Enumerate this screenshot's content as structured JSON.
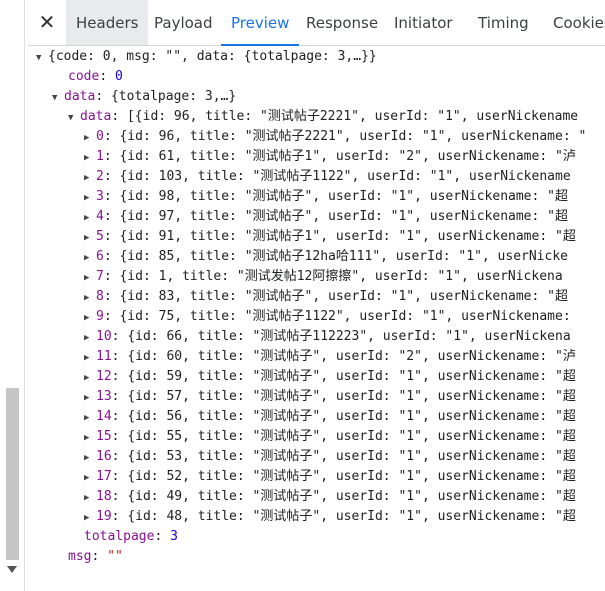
{
  "tabs": [
    {
      "label": "Headers",
      "state": "hovered"
    },
    {
      "label": "Payload",
      "state": "normal"
    },
    {
      "label": "Preview",
      "state": "active"
    },
    {
      "label": "Response",
      "state": "normal"
    },
    {
      "label": "Initiator",
      "state": "normal"
    },
    {
      "label": "Timing",
      "state": "normal"
    },
    {
      "label": "Cookies",
      "state": "normal"
    }
  ],
  "close_icon": "close-icon",
  "tree": {
    "root_summary": "{code: 0, msg: \"\", data: {totalpage: 3,…}}",
    "code_key": "code",
    "code_value": "0",
    "data_key": "data",
    "data_summary": "{totalpage: 3,…}",
    "list_key": "data",
    "list_summary": "[{id: 96, title: \"测试帖子2221\", userId: \"1\", userNickename",
    "items": [
      {
        "index": "0",
        "summary": "{id: 96, title: \"测试帖子2221\", userId: \"1\", userNickename: \""
      },
      {
        "index": "1",
        "summary": "{id: 61, title: \"测试帖子1\", userId: \"2\", userNickename: \"泸"
      },
      {
        "index": "2",
        "summary": "{id: 103, title: \"测试帖子1122\", userId: \"1\", userNickename"
      },
      {
        "index": "3",
        "summary": "{id: 98, title: \"测试帖子\", userId: \"1\", userNickename: \"超"
      },
      {
        "index": "4",
        "summary": "{id: 97, title: \"测试帖子\", userId: \"1\", userNickename: \"超"
      },
      {
        "index": "5",
        "summary": "{id: 91, title: \"测试帖子1\", userId: \"1\", userNickename: \"超"
      },
      {
        "index": "6",
        "summary": "{id: 85, title: \"测试帖子12ha哈111\", userId: \"1\", userNicke"
      },
      {
        "index": "7",
        "summary": "{id: 1, title: \"测试发帖12阿擦擦\", userId: \"1\", userNickena"
      },
      {
        "index": "8",
        "summary": "{id: 83, title: \"测试帖子\", userId: \"1\", userNickename: \"超"
      },
      {
        "index": "9",
        "summary": "{id: 75, title: \"测试帖子1122\", userId: \"1\", userNickename:"
      },
      {
        "index": "10",
        "summary": "{id: 66, title: \"测试帖子112223\", userId: \"1\", userNickena"
      },
      {
        "index": "11",
        "summary": "{id: 60, title: \"测试帖子\", userId: \"2\", userNickename: \"泸"
      },
      {
        "index": "12",
        "summary": "{id: 59, title: \"测试帖子\", userId: \"1\", userNickename: \"超"
      },
      {
        "index": "13",
        "summary": "{id: 57, title: \"测试帖子\", userId: \"1\", userNickename: \"超"
      },
      {
        "index": "14",
        "summary": "{id: 56, title: \"测试帖子\", userId: \"1\", userNickename: \"超"
      },
      {
        "index": "15",
        "summary": "{id: 55, title: \"测试帖子\", userId: \"1\", userNickename: \"超"
      },
      {
        "index": "16",
        "summary": "{id: 53, title: \"测试帖子\", userId: \"1\", userNickename: \"超"
      },
      {
        "index": "17",
        "summary": "{id: 52, title: \"测试帖子\", userId: \"1\", userNickename: \"超"
      },
      {
        "index": "18",
        "summary": "{id: 49, title: \"测试帖子\", userId: \"1\", userNickename: \"超"
      },
      {
        "index": "19",
        "summary": "{id: 48, title: \"测试帖子\", userId: \"1\", userNickename: \"超"
      }
    ],
    "totalpage_key": "totalpage",
    "totalpage_value": "3",
    "msg_key": "msg",
    "msg_value": "\"\""
  },
  "colors": {
    "key": "#881391",
    "number": "#1c00cf",
    "string": "#c41a16",
    "active_tab": "#1a73e8"
  }
}
